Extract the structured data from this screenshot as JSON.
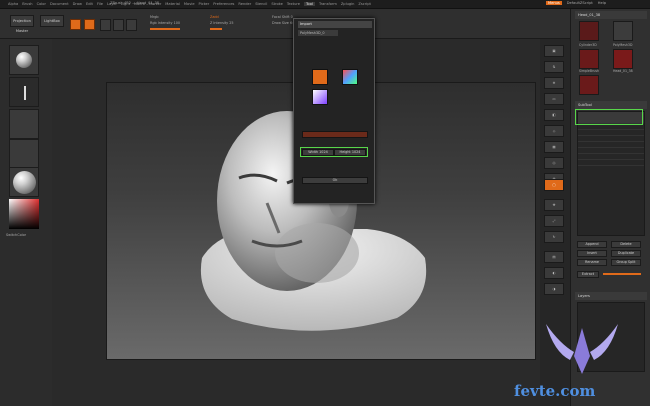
{
  "app": {
    "menu_items": [
      "Alpha",
      "Brush",
      "Color",
      "Document",
      "Draw",
      "Edit",
      "File",
      "Layer",
      "Light",
      "Macro",
      "Marker",
      "Material",
      "Movie",
      "Picker",
      "Preferences",
      "Render",
      "Stencil",
      "Stroke",
      "Texture",
      "Tool",
      "Transform",
      "Zplugin",
      "Zscript"
    ],
    "active_menu": "Tool",
    "right_menu": {
      "accent": "Menus",
      "default": "DefaultZScript",
      "help": "Help"
    }
  },
  "toolbar": {
    "buttons": [
      "Projection Master",
      "LightBox",
      "Quick Sketch",
      "Edit",
      "Draw",
      "Move",
      "Scale",
      "Rotate"
    ],
    "labels": [
      "Mrgb",
      "Rgb",
      "M",
      "Zadd",
      "Zsub",
      "Zcut",
      "Focal Shift 0",
      "Draw Size 64",
      "Rgb Intensity 100",
      "Z Intensity 25",
      "Dynamic"
    ]
  },
  "left_shelf": {
    "color_label": "SwitchColor"
  },
  "popup": {
    "title": "Import",
    "subtitle": "PolyMesh3D_0",
    "width_label": "Width 1024",
    "height_label": "Height 1024",
    "bottom_label": "Undo",
    "action_label": "Ok"
  },
  "tray": {
    "tool_title": "Tool",
    "current_tool": "Head_01_38",
    "tools": [
      "Cylinder3D",
      "PolyMesh3D",
      "SimpleBrush",
      "Head_01_38",
      "Sphere3D"
    ],
    "subtool_header": "SubTool",
    "buttons": [
      "Append",
      "Delete",
      "Insert",
      "Duplicate",
      "Rename",
      "Group Split"
    ],
    "extract_label": "Extract",
    "layers_header": "Layers"
  },
  "watermark": "fevte.com",
  "colors": {
    "accent": "#e06a1a",
    "highlight": "#58d64a"
  }
}
